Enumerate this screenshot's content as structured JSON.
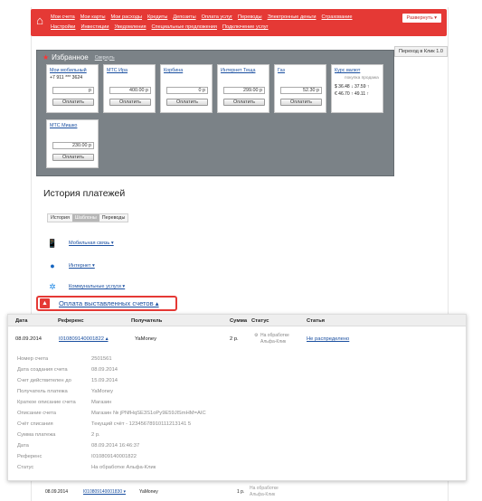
{
  "nav": {
    "row1": [
      "Мои счета",
      "Мои карты",
      "Мои расходы",
      "Кредиты",
      "Депозиты",
      "Оплата услуг",
      "Переводы",
      "Электронные деньги",
      "Страхование"
    ],
    "row2": [
      "Настройки",
      "Инвестиции",
      "Уведомления",
      "Специальные предложения",
      "Подключение услуг"
    ],
    "expand": "Развернуть ▾"
  },
  "to_old": "Переход в Клик 1.0",
  "favorites": {
    "title": "Избранное",
    "collapse": "Свернуть",
    "cards": [
      {
        "title": "Мои мобильный",
        "sub": "+7 911 *** 3624",
        "amount": "р",
        "pay": "Оплатить"
      },
      {
        "title": "МТС Ира",
        "sub": "",
        "amount": "400.00  р",
        "pay": "Оплатить"
      },
      {
        "title": "Корбина",
        "sub": "",
        "amount": "0  р",
        "pay": "Оплатить"
      },
      {
        "title": "Интернет Теща",
        "sub": "",
        "amount": "299.00  р",
        "pay": "Оплатить"
      },
      {
        "title": "Газ",
        "sub": "",
        "amount": "52.30  р",
        "pay": "Оплатить"
      },
      {
        "title": "МТС Мишко",
        "sub": "",
        "amount": "230.00  р",
        "pay": "Оплатить"
      }
    ],
    "rates": {
      "title": "Курс валют",
      "head": "покупка  продажа",
      "rows": [
        "$ 36.48 ↓  37.59 ↑",
        "€ 46.70 ↑  49.11 ↑"
      ]
    }
  },
  "history": {
    "title": "История платежей",
    "tabs": [
      "История",
      "Шаблоны",
      "Переводы"
    ],
    "categories": [
      "Мобильная связь ▾",
      "Интернет ▾",
      "Коммунальные услуги ▾"
    ],
    "issued": "Оплата выставленных счетов ▴"
  },
  "table": {
    "headers": [
      "Дата",
      "Референс",
      "Получатель",
      "Сумма",
      "Статус",
      "Статья"
    ],
    "row": {
      "date": "08.09.2014",
      "ref": "I010809140001822 ▴",
      "recipient": "YaMoney",
      "sum": "2 р.",
      "status1": "На обработке",
      "status2": "Альфа-Клик",
      "article": "Не распределено"
    },
    "details": [
      [
        "Номер счета",
        "2501561"
      ],
      [
        "Дата создания счета",
        "08.09.2014"
      ],
      [
        "Счет действителен до",
        "15.09.2014"
      ],
      [
        "Получатель платежа",
        "YaMoney"
      ],
      [
        "Краткое описание счета",
        "Магазин"
      ],
      [
        "Описание счета",
        "Магазин      № jPNfHqSE3S1oPy9E59JlSmHM=AIC"
      ],
      [
        "Счёт списания",
        "Текущий счёт - 12345678910111213141 5"
      ],
      [
        "Сумма платежа",
        "2 р."
      ],
      [
        "Дата",
        "08.09.2014 16:46:37"
      ],
      [
        "Референс",
        "I010809140001822"
      ],
      [
        "Статус",
        "На обработке    Альфа-Клик"
      ]
    ],
    "row2": {
      "date": "08.09.2014",
      "ref": "I010809140001830 ▾",
      "recipient": "YaMoney",
      "sum": "1 р.",
      "status1": "На обработке",
      "status2": "Альфа-Клик"
    }
  }
}
